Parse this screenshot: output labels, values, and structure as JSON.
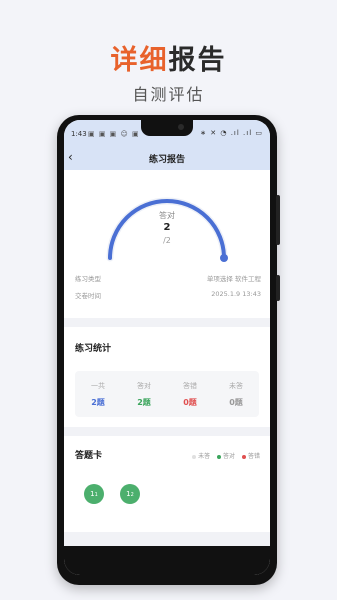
{
  "hero": {
    "title_part1": "详细",
    "title_part2": "报告",
    "subtitle": "自测评估"
  },
  "status": {
    "time": "1:43",
    "left_icons": "▣ ▣ ▣ ☺ ▣",
    "right_icons": "∗ ✕ ◔ .ıl .ıl ▭"
  },
  "nav": {
    "back": "‹",
    "title": "练习报告"
  },
  "gauge": {
    "label": "答对",
    "value": "2",
    "total": "/2",
    "fraction": 1.0,
    "color": "#4a6fd4"
  },
  "info": [
    {
      "label": "练习类型",
      "value": "单项选择 软件工程"
    },
    {
      "label": "交卷时间",
      "value": "2025.1.9 13:43"
    }
  ],
  "stats": {
    "title": "练习统计",
    "items": [
      {
        "label": "一共",
        "value": "2题",
        "color": "#4a6fd4"
      },
      {
        "label": "答对",
        "value": "2题",
        "color": "#3ba55c"
      },
      {
        "label": "答错",
        "value": "0题",
        "color": "#e05050"
      },
      {
        "label": "未答",
        "value": "0题",
        "color": "#999999"
      }
    ]
  },
  "answer_card": {
    "title": "答题卡",
    "legend": [
      {
        "label": "未答",
        "color": "#e0e0e0"
      },
      {
        "label": "答对",
        "color": "#3ba55c"
      },
      {
        "label": "答错",
        "color": "#e05050"
      }
    ],
    "questions": [
      {
        "num": "1",
        "sub": "1"
      },
      {
        "num": "1",
        "sub": "2"
      }
    ]
  }
}
